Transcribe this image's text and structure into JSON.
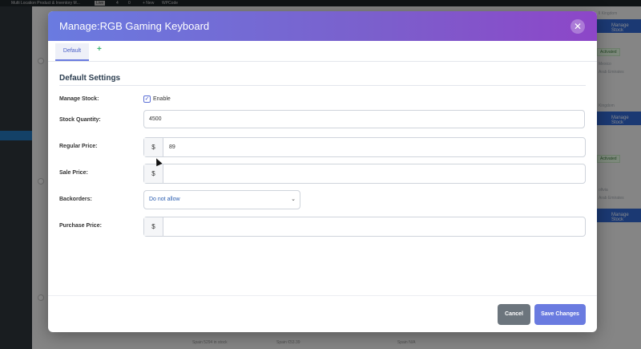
{
  "background": {
    "adminbar": [
      "Multi Location Product & Inventory M...",
      "Live",
      "4",
      "0",
      "+ New",
      "WPCode"
    ],
    "right_bar_label": "Manage Stock",
    "right_texts": [
      "ll Kingdom",
      "Mexico",
      "Arab Emirates",
      "Kingdom",
      "oltvia",
      "Arab Emirates"
    ],
    "badge_label": "Activated",
    "bottom_texts": [
      "Spain  5294 in stock",
      "Spain  €53.39",
      "Spain  N/A"
    ]
  },
  "modal": {
    "title": "Manage:RGB Gaming Keyboard",
    "close_glyph": "✕"
  },
  "tabs": {
    "default_label": "Default",
    "add_glyph": "+"
  },
  "section": {
    "title": "Default Settings"
  },
  "fields": {
    "manage_stock_label": "Manage Stock:",
    "enable_label": "Enable",
    "enable_checked": true,
    "stock_quantity_label": "Stock Quantity:",
    "stock_quantity_value": "4500",
    "regular_price_label": "Regular Price:",
    "regular_price_value": "89",
    "sale_price_label": "Sale Price:",
    "sale_price_value": "",
    "backorders_label": "Backorders:",
    "backorders_value": "Do not allow",
    "purchase_price_label": "Purchase Price:",
    "purchase_price_value": "",
    "currency_symbol": "$"
  },
  "footer": {
    "cancel_label": "Cancel",
    "save_label": "Save Changes"
  },
  "icons": {
    "checkmark": "✓",
    "chevron": "⌄"
  }
}
